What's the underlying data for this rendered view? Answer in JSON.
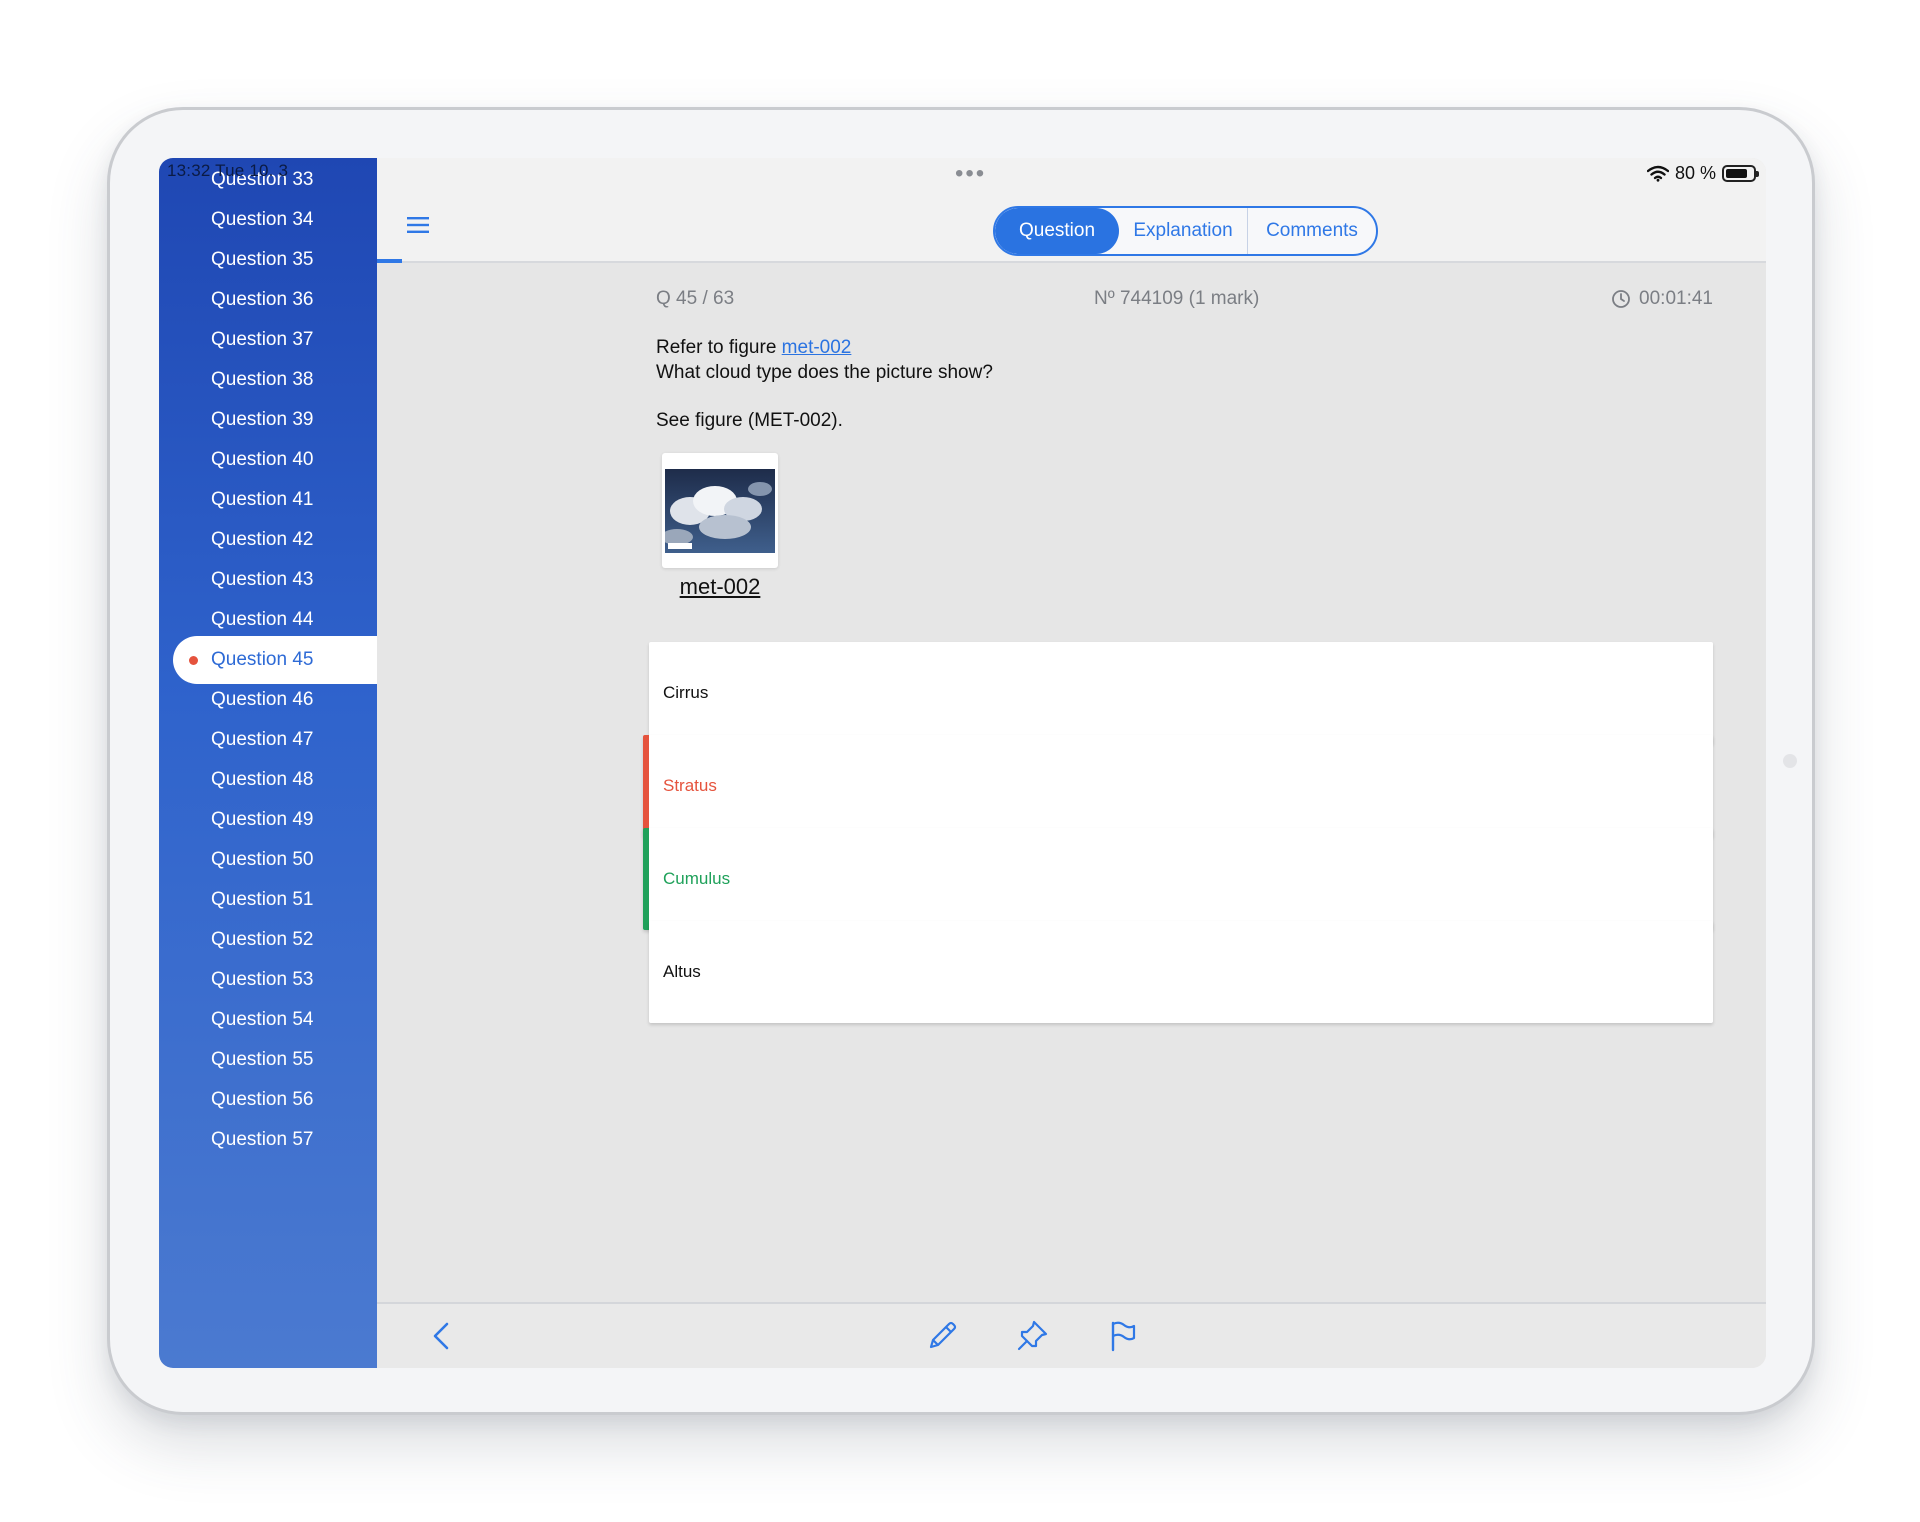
{
  "status_bar": {
    "time": "13:32 Tue 10. 3",
    "battery": "80 %",
    "battery_level_percent": 80
  },
  "sidebar": {
    "items": [
      {
        "label": "Question 33"
      },
      {
        "label": "Question 34"
      },
      {
        "label": "Question 35"
      },
      {
        "label": "Question 36"
      },
      {
        "label": "Question 37"
      },
      {
        "label": "Question 38"
      },
      {
        "label": "Question 39"
      },
      {
        "label": "Question 40"
      },
      {
        "label": "Question 41"
      },
      {
        "label": "Question 42"
      },
      {
        "label": "Question 43"
      },
      {
        "label": "Question 44"
      },
      {
        "label": "Question 45",
        "active": true
      },
      {
        "label": "Question 46"
      },
      {
        "label": "Question 47"
      },
      {
        "label": "Question 48"
      },
      {
        "label": "Question 49"
      },
      {
        "label": "Question 50"
      },
      {
        "label": "Question 51"
      },
      {
        "label": "Question 52"
      },
      {
        "label": "Question 53"
      },
      {
        "label": "Question 54"
      },
      {
        "label": "Question 55"
      },
      {
        "label": "Question 56"
      },
      {
        "label": "Question 57"
      }
    ]
  },
  "tabs": {
    "question": "Question",
    "explanation": "Explanation",
    "comments": "Comments",
    "selected": "Question"
  },
  "question": {
    "counter": "Q 45 / 63",
    "number": "Nº 744109 (1 mark)",
    "timer": "00:01:41",
    "refer_prefix": "Refer to figure ",
    "refer_link": "met-002",
    "prompt": "What cloud type does the picture show?",
    "see_figure": "See figure (MET-002).",
    "figure_caption": "met-002"
  },
  "answers": [
    {
      "label": "Cirrus",
      "state": "neutral"
    },
    {
      "label": "Stratus",
      "state": "wrong"
    },
    {
      "label": "Cumulus",
      "state": "correct"
    },
    {
      "label": "Altus",
      "state": "neutral"
    }
  ],
  "toolbar": {
    "icons": [
      "back-icon",
      "pencil-icon",
      "pin-icon",
      "flag-icon"
    ]
  },
  "colors": {
    "accent": "#2f78e6",
    "wrong": "#e5533d",
    "correct": "#1fa15a",
    "sidebar_top": "#1f47b3",
    "sidebar_bottom": "#4b7ad0"
  }
}
